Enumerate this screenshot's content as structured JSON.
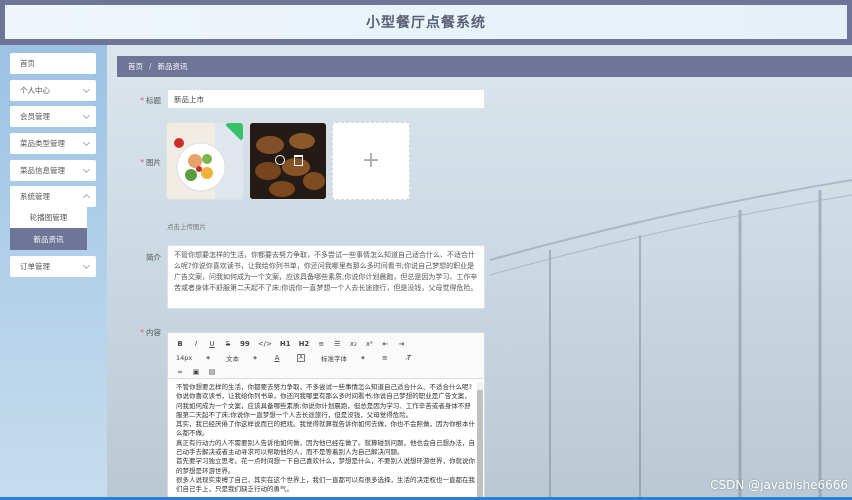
{
  "header": {
    "title": "小型餐厅点餐系统"
  },
  "sidebar": {
    "items": [
      {
        "label": "首页",
        "has_arrow": false
      },
      {
        "label": "个人中心",
        "has_arrow": true
      },
      {
        "label": "会员管理",
        "has_arrow": true
      },
      {
        "label": "菜品类型管理",
        "has_arrow": true
      },
      {
        "label": "菜品信息管理",
        "has_arrow": true
      },
      {
        "label": "系统管理",
        "has_arrow": true
      },
      {
        "label": "订单管理",
        "has_arrow": true
      }
    ],
    "submenu": [
      {
        "label": "轮播图管理",
        "active": false
      },
      {
        "label": "新品资讯",
        "active": true
      }
    ]
  },
  "breadcrumb": {
    "home": "首页",
    "separator": "/",
    "current": "新品资讯"
  },
  "form": {
    "title_label": "标题",
    "title_value": "新品上市",
    "image_label": "图片",
    "upload_tip": "点击上传图片",
    "intro_label": "简介",
    "intro_value": "不管你想要怎样的生活，你都要去努力争取，不多尝试一些事情怎么知道自己适合什么、不适合什么呢?你说你喜欢读书，让我给你列书单，你还问我哪里有那么多时间看书;你说自己梦想的职业是广告文案，问我如何成为一个文案，应该具备哪些素质;你说你计划晨跑，但总是因为学习、工作辛苦或者身体不舒服第二天起不了床;你说你一直梦想一个人去长途旅行，但是没钱，父母觉得危险。",
    "content_label": "内容"
  },
  "editor": {
    "toolbar_row1": [
      "B",
      "I",
      "U",
      "S",
      "99",
      "</>",
      "H1",
      "H2",
      "≡",
      "☰",
      "x₂",
      "x²",
      "⇤",
      "⇥"
    ],
    "font_size": "14px",
    "font_format": "文本",
    "font_family": "标准字体",
    "content_lines": [
      "不管你想要怎样的生活，你都要去努力争取，不多尝试一些事情怎么知道自己适合什么、不适合什么呢?",
      "你说你喜欢读书，让我给你列书单，你还问我哪里有那么多时间看书;你说自己梦想的职业是广告文案，问我如何成为一个文案，应该具备哪些素质;你说你计划晨跑，但总是因为学习、工作辛苦或者身体不舒服第二天起不了床;你说你一直梦想一个人去长途旅行，但是没钱，父母觉得危险。",
      "其实，我已经厌倦了你这样说而已的把戏。我觉得就算我告诉你如何去做，你也不会照做，因为你根本什么都不做。",
      "真正有行动力的人不需要别人告诉他如何做，因为他已经在做了。就算碰到问题，他也会自己想办法，自己动手去解决或者主动寻求可以帮助他的人，而不是等着别人为自己解决问题。",
      "首先要学习独立思考。花一点时间想一下自己喜欢什么，梦想是什么，不要别人说想环游世界，你就说你的梦想是环游世界。",
      "很多人说现实束缚了自己，其实在这个世界上，我们一直都可以有很多选择，生活的决定权也一直都在我们自己手上，只是我们缺乏行动的勇气。"
    ]
  },
  "watermark": "CSDN @javabishe6666"
}
